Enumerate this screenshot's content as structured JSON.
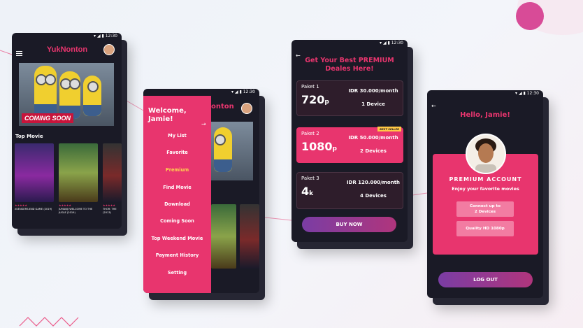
{
  "colors": {
    "accent": "#e8356e",
    "dark": "#1a1a26",
    "gold": "#ffd44d",
    "purple": "#7a3da4"
  },
  "status": {
    "time": "12:30"
  },
  "home": {
    "logo": "YukNonton",
    "banner_label": "COMING SOON",
    "section_title": "Top Movie",
    "posters": [
      {
        "title": "AVENGERS:END GAME (2019)",
        "stars": "★★★★★"
      },
      {
        "title": "JUMANJI WELCOME TO THE JUGLE (2019)",
        "stars": "★★★★★"
      },
      {
        "title": "THOR: THE (2013)",
        "stars": "★★★★★"
      }
    ]
  },
  "drawer": {
    "welcome": "Welcome, Jamie!",
    "arrow": "→",
    "bg_logo": "onton",
    "items": [
      {
        "label": "My List"
      },
      {
        "label": "Favorite"
      },
      {
        "label": "Premium",
        "active": true
      },
      {
        "label": "Find Movie"
      },
      {
        "label": "Download"
      },
      {
        "label": "Coming Soon"
      },
      {
        "label": "Top Weekend Movie"
      },
      {
        "label": "Payment History"
      },
      {
        "label": "Setting"
      }
    ]
  },
  "premium": {
    "back": "←",
    "title_line1": "Get Your Best PREMIUM",
    "title_line2": "Deales Here!",
    "packages": [
      {
        "name": "Paket 1",
        "res": "720",
        "unit": "p",
        "price": "IDR 30.000/month",
        "devices": "1 Device",
        "selected": false
      },
      {
        "name": "Paket 2",
        "res": "1080",
        "unit": "p",
        "price": "IDR 50.000/month",
        "devices": "2 Devices",
        "selected": true,
        "badge": "BEST SELLER"
      },
      {
        "name": "Paket 3",
        "res": "4",
        "unit": "k",
        "price": "IDR 120.000/month",
        "devices": "4 Devices",
        "selected": false
      }
    ],
    "buy_label": "BUY NOW"
  },
  "account": {
    "back": "←",
    "hello": "Hello, Jamie!",
    "account_type": "PREMIUM ACCOUNT",
    "enjoy": "Enjoy your favorite movies",
    "features": [
      "Connect up to",
      "2 Devices",
      "Quality HD 1080p"
    ],
    "logout_label": "LOG OUT"
  }
}
